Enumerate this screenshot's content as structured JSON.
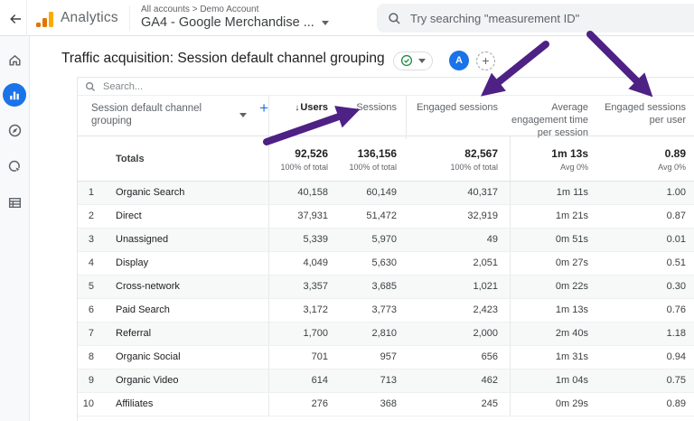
{
  "topbar": {
    "product": "Analytics",
    "breadcrumb": "All accounts > Demo Account",
    "account_selector": "GA4 - Google Merchandise ...",
    "search_placeholder": "Try searching \"measurement ID\""
  },
  "sidebar": {
    "items": [
      "home",
      "reports",
      "explore",
      "advertising",
      "library"
    ],
    "active_item": "reports"
  },
  "report_header": {
    "title": "Traffic acquisition: Session default channel grouping",
    "avatar_label": "A",
    "add_label": "+"
  },
  "table": {
    "search_placeholder": "Search...",
    "dimension_header": "Session default channel grouping",
    "add_dimension_label": "+",
    "sort_icon": "↓",
    "column_headers": {
      "users": "Users",
      "sessions": "Sessions",
      "engaged_sessions": "Engaged sessions",
      "avg_engagement_time": "Average engagement time per session",
      "engaged_sessions_per_user": "Engaged sessions per user"
    },
    "totals": {
      "label": "Totals",
      "users": "92,526",
      "users_sub": "100% of total",
      "sessions": "136,156",
      "sessions_sub": "100% of total",
      "engaged_sessions": "82,567",
      "engaged_sessions_sub": "100% of total",
      "avg_engagement_time": "1m 13s",
      "avg_engagement_time_sub": "Avg 0%",
      "engaged_sessions_per_user": "0.89",
      "engaged_sessions_per_user_sub": "Avg 0%"
    },
    "rows": [
      [
        "1",
        "Organic Search",
        "40,158",
        "60,149",
        "40,317",
        "1m 11s",
        "1.00"
      ],
      [
        "2",
        "Direct",
        "37,931",
        "51,472",
        "32,919",
        "1m 21s",
        "0.87"
      ],
      [
        "3",
        "Unassigned",
        "5,339",
        "5,970",
        "49",
        "0m 51s",
        "0.01"
      ],
      [
        "4",
        "Display",
        "4,049",
        "5,630",
        "2,051",
        "0m 27s",
        "0.51"
      ],
      [
        "5",
        "Cross-network",
        "3,357",
        "3,685",
        "1,021",
        "0m 22s",
        "0.30"
      ],
      [
        "6",
        "Paid Search",
        "3,172",
        "3,773",
        "2,423",
        "1m 13s",
        "0.76"
      ],
      [
        "7",
        "Referral",
        "1,700",
        "2,810",
        "2,000",
        "2m 40s",
        "1.18"
      ],
      [
        "8",
        "Organic Social",
        "701",
        "957",
        "656",
        "1m 31s",
        "0.94"
      ],
      [
        "9",
        "Organic Video",
        "614",
        "713",
        "462",
        "1m 04s",
        "0.75"
      ],
      [
        "10",
        "Affiliates",
        "276",
        "368",
        "245",
        "0m 29s",
        "0.89"
      ]
    ]
  },
  "colors": {
    "accent_blue": "#1a73e8",
    "annotation_purple": "#4e2185",
    "logo_orange_light": "#f9ab00",
    "logo_orange_dark": "#e37400",
    "check_green": "#1e8e3e"
  }
}
